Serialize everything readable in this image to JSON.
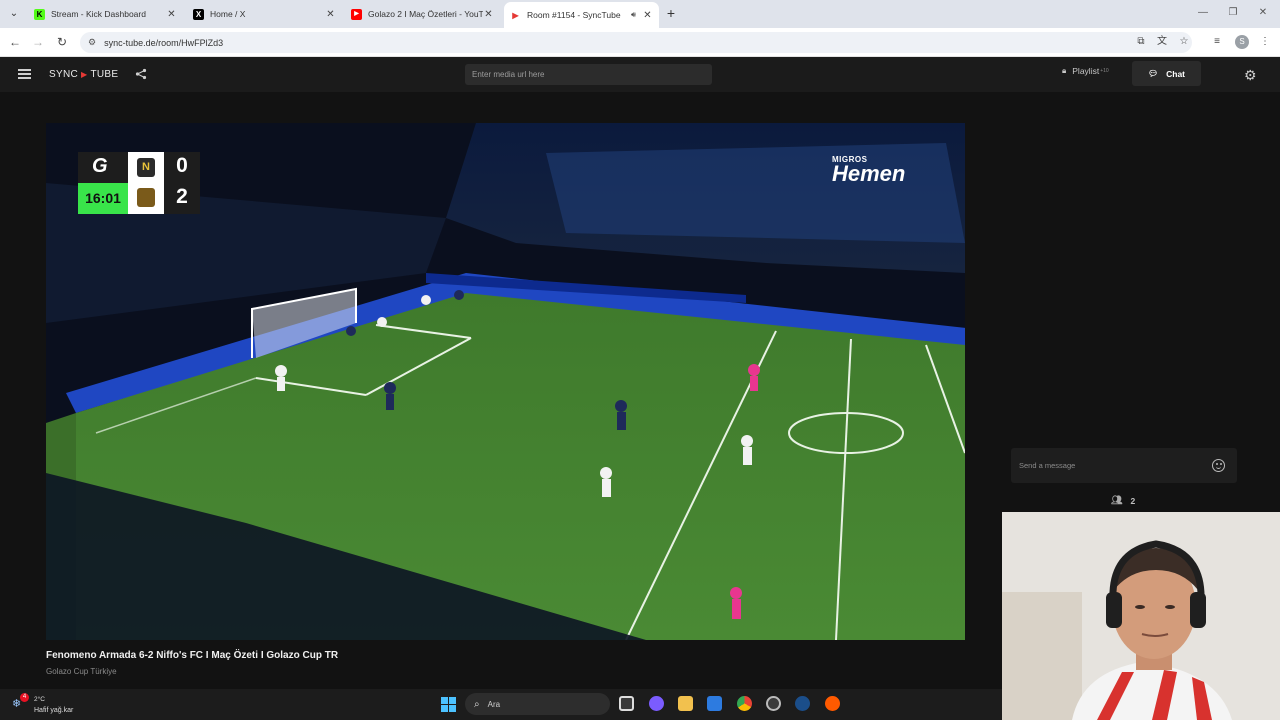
{
  "browser": {
    "tabs": [
      {
        "title": "Stream - Kick Dashboard",
        "favicon": "kick-icon",
        "color": "#53fc18",
        "glyph": "K",
        "active": false
      },
      {
        "title": "Home / X",
        "favicon": "x-icon",
        "color": "#000000",
        "glyph": "X",
        "active": false
      },
      {
        "title": "Golazo 2 I Maç Özetleri - YouTube",
        "favicon": "youtube-icon",
        "color": "#ff0000",
        "glyph": "▶",
        "active": false
      },
      {
        "title": "Room #1154 - SyncTube",
        "favicon": "synctube-icon",
        "color": "#e53935",
        "glyph": "▶",
        "active": true
      }
    ],
    "url": "sync-tube.de/room/HwFPlZd3",
    "profile_initial": "S"
  },
  "app": {
    "logo_left": "SYNC",
    "logo_right": "TUBE",
    "media_input_placeholder": "Enter media url here",
    "playlist_label": "Playlist",
    "playlist_badge": "+10",
    "chat_label": "Chat"
  },
  "video": {
    "title": "Fenomeno Armada 6-2 Niffo's FC I Maç Özeti I Golazo Cup TR",
    "channel": "Golazo Cup Türkiye",
    "scoreboard": {
      "home_score": "0",
      "away_score": "2",
      "clock": "16:01",
      "home_badge": "N"
    },
    "watermark_top": "MIGROS",
    "watermark_main": "Hemen"
  },
  "chat": {
    "input_placeholder": "Send a message",
    "viewer_count": "2"
  },
  "taskbar": {
    "weather_badge": "4",
    "temperature": "2°C",
    "weather_desc": "Hafif yağ.kar",
    "search_placeholder": "Ara"
  }
}
